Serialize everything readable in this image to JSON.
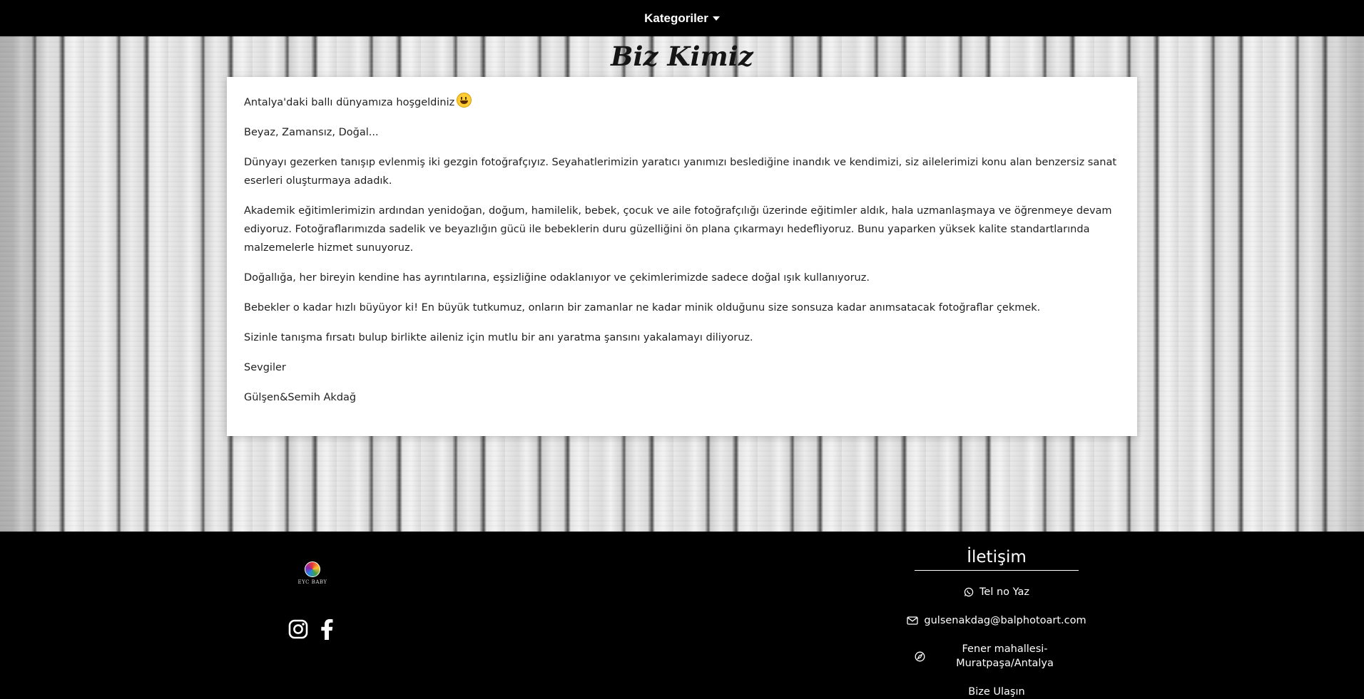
{
  "nav": {
    "dropdown_label": "Kategoriler"
  },
  "page": {
    "title": "Biz Kimiz"
  },
  "content": {
    "paragraphs": [
      "Antalya'daki ballı dünyamıza hoşgeldiniz",
      "Beyaz, Zamansız, Doğal...",
      "Dünyayı gezerken tanışıp evlenmiş iki gezgin fotoğrafçıyız. Seyahatlerimizin yaratıcı yanımızı beslediğine inandık ve kendimizi, siz ailelerimizi konu alan benzersiz sanat eserleri oluşturmaya adadık.",
      "Akademik eğitimlerimizin ardından yenidoğan, doğum, hamilelik, bebek, çocuk ve aile fotoğrafçılığı üzerinde eğitimler aldık, hala uzmanlaşmaya ve öğrenmeye devam ediyoruz. Fotoğraflarımızda sadelik ve beyazlığın gücü ile bebeklerin duru güzelliğini ön plana çıkarmayı hedefliyoruz. Bunu yaparken yüksek kalite standartlarında malzemelerle hizmet sunuyoruz.",
      "Doğallığa, her bireyin kendine has ayrıntılarına, eşsizliğine odaklanıyor ve çekimlerimizde sadece doğal ışık kullanıyoruz.",
      "Bebekler o kadar hızlı büyüyor ki! En büyük tutkumuz, onların bir zamanlar ne kadar minik olduğunu size sonsuza kadar anımsatacak fotoğraflar çekmek.",
      "Sizinle tanışma fırsatı bulup birlikte aileniz için mutlu bir anı yaratma şansını yakalamayı diliyoruz.",
      "Sevgiler",
      "Gülşen&Semih Akdağ"
    ],
    "emoji_icon": "grinning-face-icon"
  },
  "footer": {
    "logo_text": "EYC BABY",
    "social": [
      {
        "icon": "instagram-icon"
      },
      {
        "icon": "facebook-icon"
      }
    ],
    "contact": {
      "title": "İletişim",
      "phone": "Tel no Yaz",
      "email": "gulsenakdag@balphotoart.com",
      "address": "Fener mahallesi-Muratpaşa/Antalya",
      "cta": "Bize Ulaşın"
    }
  },
  "colors": {
    "nav_bg": "#000000",
    "footer_bg": "#000000",
    "card_bg": "#ffffff",
    "text": "#222222"
  }
}
